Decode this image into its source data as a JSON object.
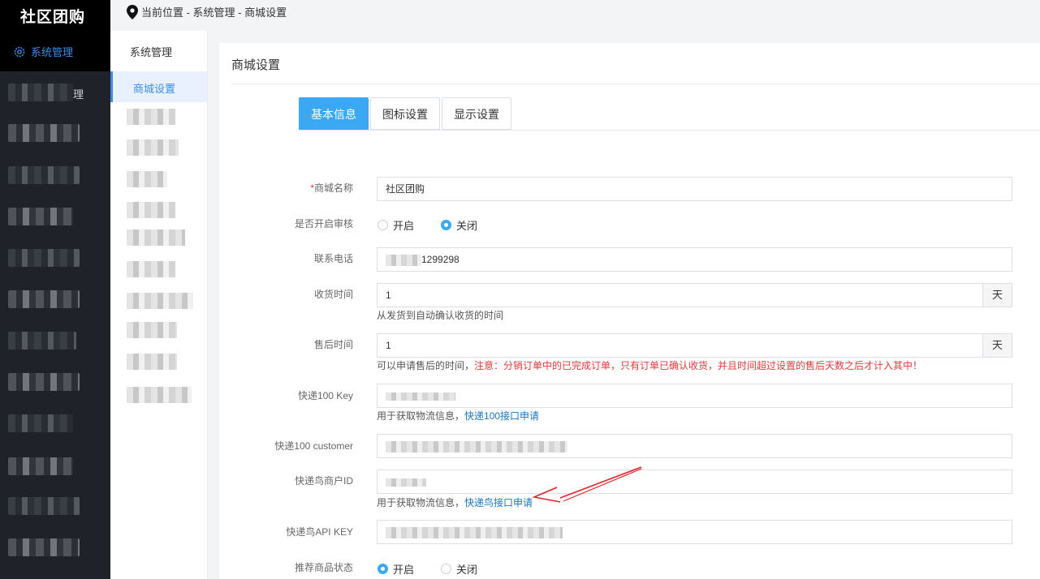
{
  "app": {
    "title": "社区团购"
  },
  "sidebar": {
    "active_label": "系统管理",
    "items": [
      {
        "suffix": "理"
      },
      {
        "suffix": ""
      },
      {
        "suffix": ""
      },
      {
        "suffix": ""
      },
      {
        "suffix": ""
      },
      {
        "suffix": ""
      },
      {
        "suffix": ""
      },
      {
        "suffix": ""
      },
      {
        "suffix": ""
      },
      {
        "suffix": ""
      },
      {
        "suffix": ""
      },
      {
        "suffix": ""
      },
      {
        "suffix": ""
      }
    ]
  },
  "breadcrumb": {
    "text": "当前位置 - 系统管理 - 商城设置"
  },
  "submenu": {
    "title": "系统管理",
    "active": "商城设置"
  },
  "panel": {
    "title": "商城设置"
  },
  "tabs": [
    "基本信息",
    "图标设置",
    "显示设置"
  ],
  "form": {
    "shop_name": {
      "label": "商城名称",
      "value": "社区团购"
    },
    "audit": {
      "label": "是否开启审核",
      "option_on": "开启",
      "option_off": "关闭",
      "selected": "关闭"
    },
    "phone": {
      "label": "联系电话",
      "value": "1299298"
    },
    "receive_time": {
      "label": "收货时间",
      "value": "1",
      "unit": "天",
      "help": "从发货到自动确认收货的时间"
    },
    "after_sale": {
      "label": "售后时间",
      "value": "1",
      "unit": "天",
      "help": "可以申请售后的时间，",
      "warning": "注意：分销订单中的已完成订单，只有订单已确认收货，并且时间超过设置的售后天数之后才计入其中！"
    },
    "kd100_key": {
      "label": "快递100 Key",
      "help": "用于获取物流信息，",
      "link": "快递100接口申请"
    },
    "kd100_customer": {
      "label": "快递100 customer"
    },
    "kdn_id": {
      "label": "快递鸟商户ID",
      "help": "用于获取物流信息，",
      "link": "快递鸟接口申请"
    },
    "kdn_key": {
      "label": "快递鸟API KEY"
    },
    "recommend": {
      "label": "推荐商品状态",
      "option_on": "开启",
      "option_off": "关闭",
      "selected": "开启"
    }
  },
  "colors": {
    "accent": "#3aa8f3",
    "sidebar_bg": "#1f2329",
    "warn": "#e4393c",
    "link": "#1a73c8"
  }
}
